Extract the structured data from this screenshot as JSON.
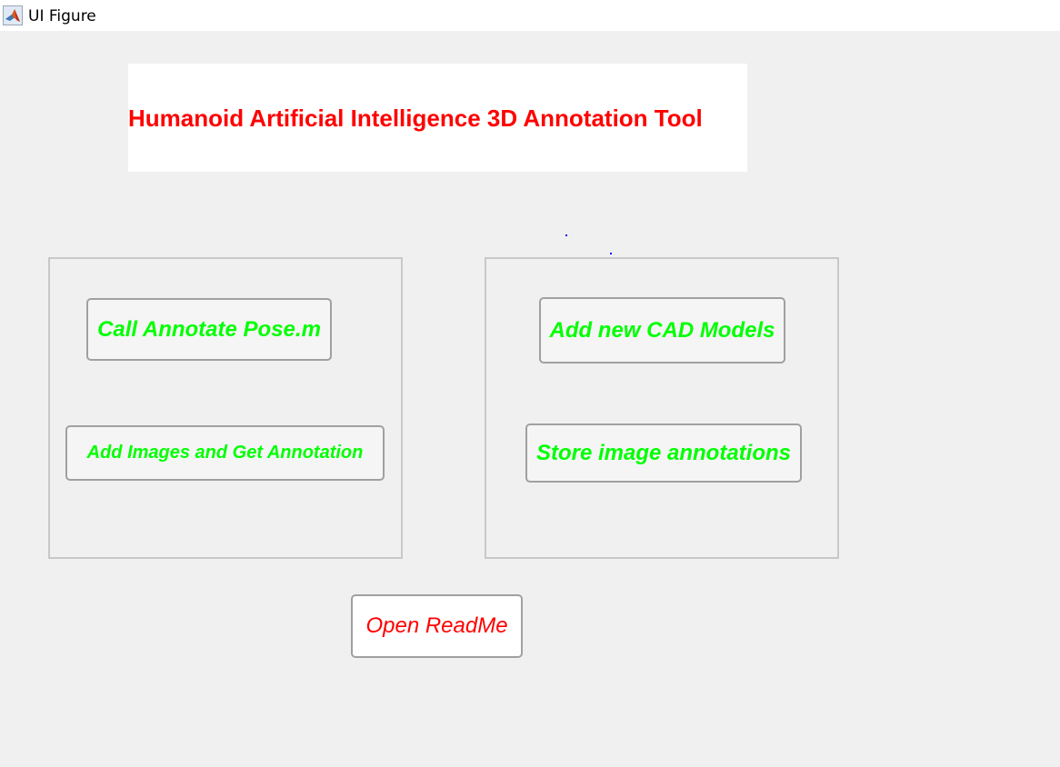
{
  "window": {
    "title": "UI Figure",
    "icon": "matlab-icon"
  },
  "header": {
    "title": "Humanoid Artificial Intelligence 3D Annotation Tool",
    "title_color": "#ff0000"
  },
  "left_panel": {
    "buttons": [
      {
        "label": "Call Annotate Pose.m"
      },
      {
        "label": "Add Images and Get Annotation"
      }
    ]
  },
  "right_panel": {
    "buttons": [
      {
        "label": "Add new CAD Models"
      },
      {
        "label": "Store image annotations"
      }
    ]
  },
  "footer": {
    "readme_label": "Open ReadMe"
  },
  "colors": {
    "background": "#f0f0f0",
    "button_text": "#00ff00",
    "readme_text": "#ff0000",
    "panel_border": "#c8c8c8"
  }
}
